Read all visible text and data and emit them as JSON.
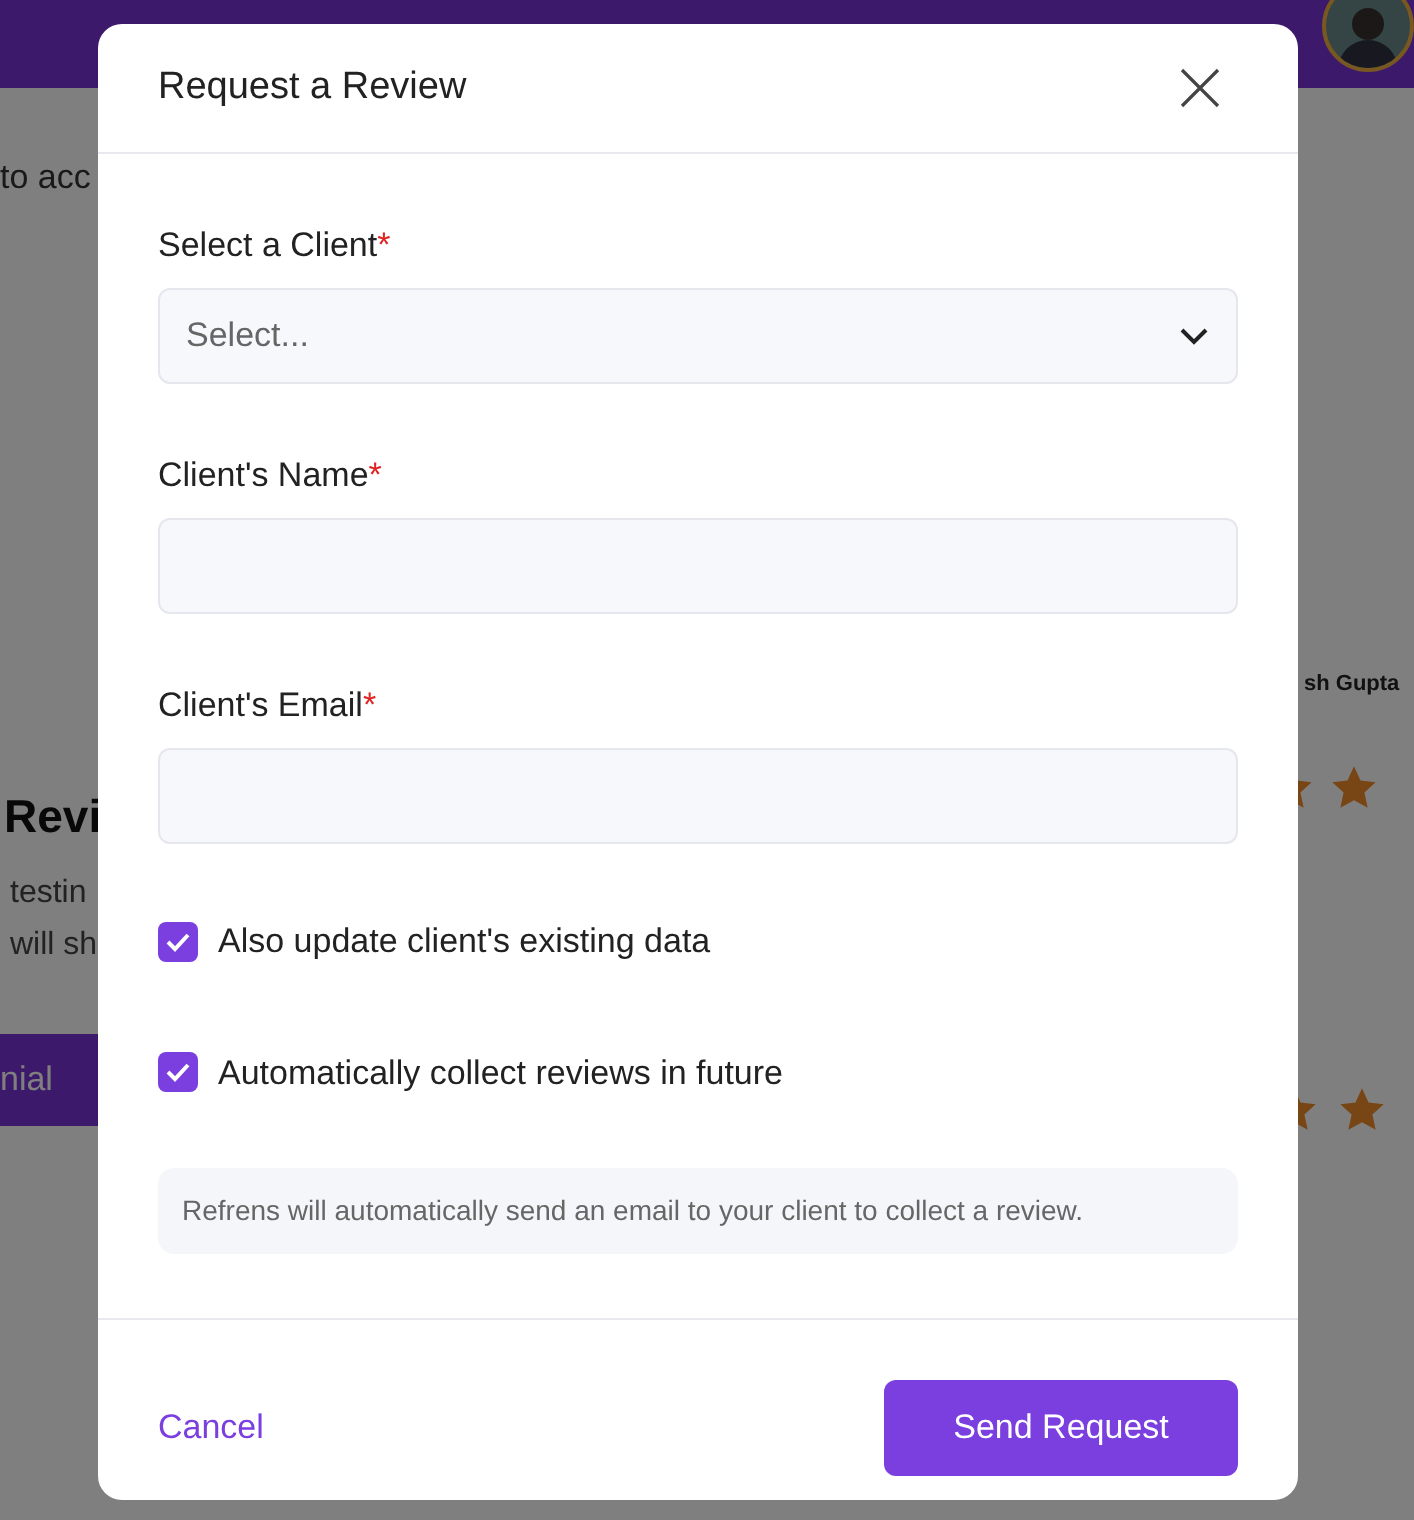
{
  "background": {
    "intro_text": "to acc",
    "heading": "Revi",
    "body_lines": [
      "testin",
      "will sh"
    ],
    "button": "nial",
    "card_name": "sh Gupta"
  },
  "dialog": {
    "title": "Request a Review",
    "fields": [
      {
        "kind": "select",
        "label": "Select a Client",
        "required_mark": "*",
        "placeholder": "Select..."
      },
      {
        "kind": "text",
        "label": "Client's Name",
        "required_mark": "*"
      },
      {
        "kind": "text",
        "label": "Client's Email",
        "required_mark": "*"
      }
    ],
    "checkboxes": [
      {
        "label": "Also update client's existing data",
        "checked": true
      },
      {
        "label": "Automatically collect reviews in future",
        "checked": true
      }
    ],
    "note": "Refrens will automatically send an email to your client to collect a review.",
    "cancel": "Cancel",
    "submit": "Send Request"
  }
}
